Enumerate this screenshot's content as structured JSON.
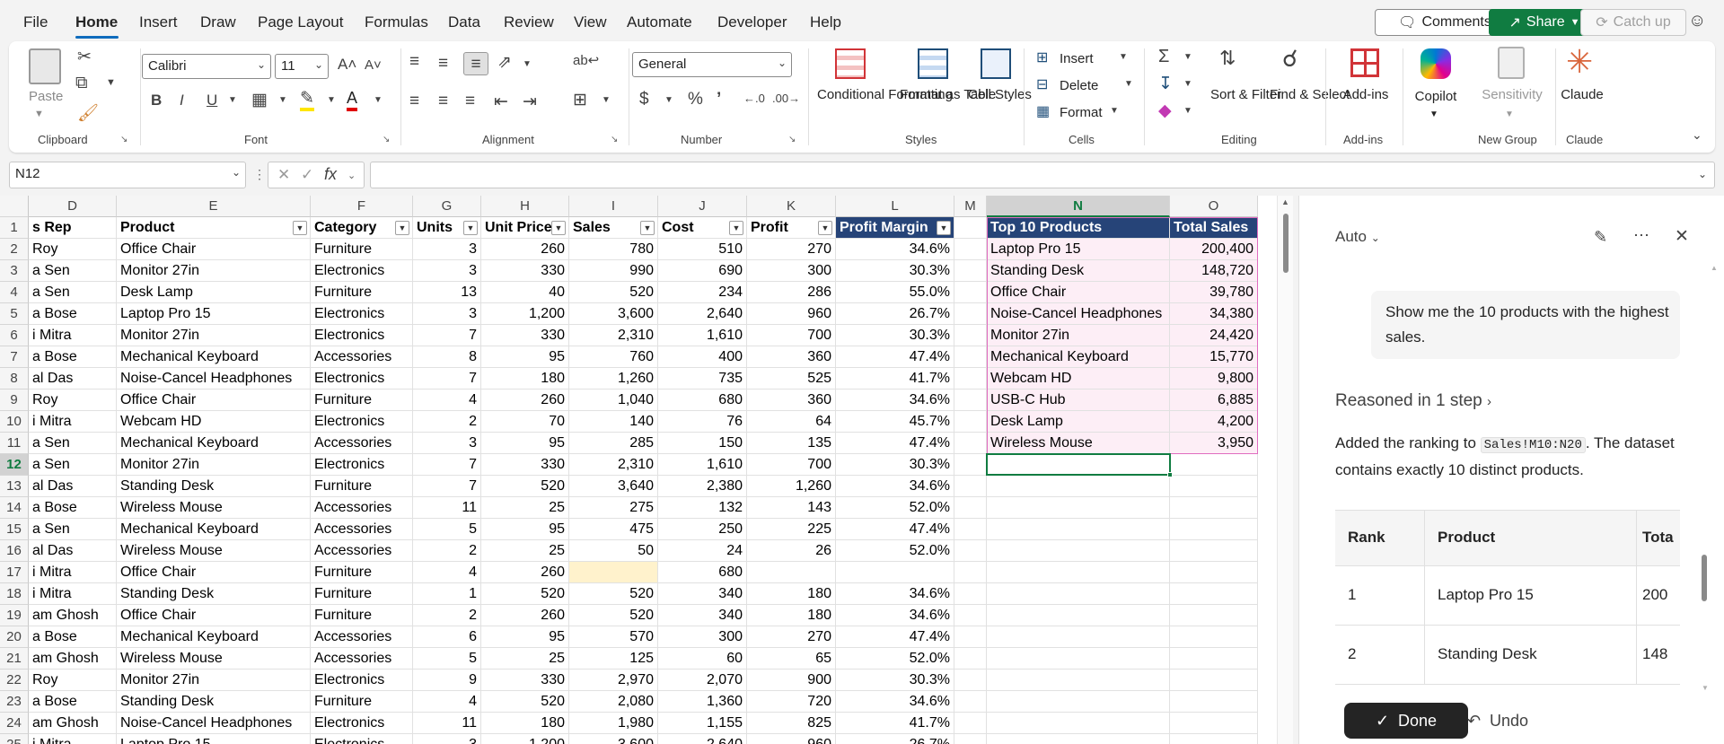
{
  "menu": {
    "tabs": [
      "File",
      "Home",
      "Insert",
      "Draw",
      "Page Layout",
      "Formulas",
      "Data",
      "Review",
      "View",
      "Automate",
      "Developer",
      "Help"
    ],
    "active": "Home",
    "comments_label": "Comments",
    "share_label": "Share",
    "catchup_label": "Catch up"
  },
  "ribbon": {
    "paste_label": "Paste",
    "font_name": "Calibri",
    "font_size": "11",
    "number_format": "General",
    "conditional_formatting": "Conditional Formatting",
    "format_as_table": "Format as Table",
    "cell_styles": "Cell Styles",
    "insert_label": "Insert",
    "delete_label": "Delete",
    "format_label": "Format",
    "sort_filter": "Sort & Filter",
    "find_select": "Find & Select",
    "addins_label": "Add-ins",
    "copilot_label": "Copilot",
    "sensitivity_label": "Sensitivity",
    "claude_label": "Claude",
    "groups": {
      "clipboard": "Clipboard",
      "font": "Font",
      "alignment": "Alignment",
      "number": "Number",
      "styles": "Styles",
      "cells": "Cells",
      "editing": "Editing",
      "addins": "Add-ins",
      "newgroup": "New Group",
      "claude": "Claude"
    }
  },
  "formula_bar": {
    "name_box": "N12",
    "formula": ""
  },
  "sheet": {
    "columns": [
      "D",
      "E",
      "F",
      "G",
      "H",
      "I",
      "J",
      "K",
      "L",
      "M",
      "N",
      "O"
    ],
    "header_row": [
      "s Rep",
      "Product",
      "Category",
      "Units",
      "Unit Price",
      "Sales",
      "Cost",
      "Profit",
      "Profit Margin"
    ],
    "rows": [
      [
        "Roy",
        "Office Chair",
        "Furniture",
        "3",
        "260",
        "780",
        "510",
        "270",
        "34.6%"
      ],
      [
        "a Sen",
        "Monitor 27in",
        "Electronics",
        "3",
        "330",
        "990",
        "690",
        "300",
        "30.3%"
      ],
      [
        "a Sen",
        "Desk Lamp",
        "Furniture",
        "13",
        "40",
        "520",
        "234",
        "286",
        "55.0%"
      ],
      [
        "a Bose",
        "Laptop Pro 15",
        "Electronics",
        "3",
        "1,200",
        "3,600",
        "2,640",
        "960",
        "26.7%"
      ],
      [
        "i Mitra",
        "Monitor 27in",
        "Electronics",
        "7",
        "330",
        "2,310",
        "1,610",
        "700",
        "30.3%"
      ],
      [
        "a Bose",
        "Mechanical Keyboard",
        "Accessories",
        "8",
        "95",
        "760",
        "400",
        "360",
        "47.4%"
      ],
      [
        "al Das",
        "Noise-Cancel Headphones",
        "Electronics",
        "7",
        "180",
        "1,260",
        "735",
        "525",
        "41.7%"
      ],
      [
        "Roy",
        "Office Chair",
        "Furniture",
        "4",
        "260",
        "1,040",
        "680",
        "360",
        "34.6%"
      ],
      [
        "i Mitra",
        "Webcam HD",
        "Electronics",
        "2",
        "70",
        "140",
        "76",
        "64",
        "45.7%"
      ],
      [
        "a Sen",
        "Mechanical Keyboard",
        "Accessories",
        "3",
        "95",
        "285",
        "150",
        "135",
        "47.4%"
      ],
      [
        "a Sen",
        "Monitor 27in",
        "Electronics",
        "7",
        "330",
        "2,310",
        "1,610",
        "700",
        "30.3%"
      ],
      [
        "al Das",
        "Standing Desk",
        "Furniture",
        "7",
        "520",
        "3,640",
        "2,380",
        "1,260",
        "34.6%"
      ],
      [
        "a Bose",
        "Wireless Mouse",
        "Accessories",
        "11",
        "25",
        "275",
        "132",
        "143",
        "52.0%"
      ],
      [
        "a Sen",
        "Mechanical Keyboard",
        "Accessories",
        "5",
        "95",
        "475",
        "250",
        "225",
        "47.4%"
      ],
      [
        "al Das",
        "Wireless Mouse",
        "Accessories",
        "2",
        "25",
        "50",
        "24",
        "26",
        "52.0%"
      ],
      [
        "i Mitra",
        "Office Chair",
        "Furniture",
        "4",
        "260",
        "",
        "680",
        "",
        ""
      ],
      [
        "i Mitra",
        "Standing Desk",
        "Furniture",
        "1",
        "520",
        "520",
        "340",
        "180",
        "34.6%"
      ],
      [
        "am Ghosh",
        "Office Chair",
        "Furniture",
        "2",
        "260",
        "520",
        "340",
        "180",
        "34.6%"
      ],
      [
        "a Bose",
        "Mechanical Keyboard",
        "Accessories",
        "6",
        "95",
        "570",
        "300",
        "270",
        "47.4%"
      ],
      [
        "am Ghosh",
        "Wireless Mouse",
        "Accessories",
        "5",
        "25",
        "125",
        "60",
        "65",
        "52.0%"
      ],
      [
        "Roy",
        "Monitor 27in",
        "Electronics",
        "9",
        "330",
        "2,970",
        "2,070",
        "900",
        "30.3%"
      ],
      [
        "a Bose",
        "Standing Desk",
        "Furniture",
        "4",
        "520",
        "2,080",
        "1,360",
        "720",
        "34.6%"
      ],
      [
        "am Ghosh",
        "Noise-Cancel Headphones",
        "Electronics",
        "11",
        "180",
        "1,980",
        "1,155",
        "825",
        "41.7%"
      ],
      [
        "i Mitra",
        "Laptop Pro 15",
        "Electronics",
        "3",
        "1,200",
        "3,600",
        "2,640",
        "960",
        "26.7%"
      ]
    ],
    "top10": {
      "header_product": "Top 10 Products",
      "header_sales": "Total Sales",
      "rows": [
        [
          "Laptop Pro 15",
          "200,400"
        ],
        [
          "Standing Desk",
          "148,720"
        ],
        [
          "Office Chair",
          "39,780"
        ],
        [
          "Noise-Cancel Headphones",
          "34,380"
        ],
        [
          "Monitor 27in",
          "24,420"
        ],
        [
          "Mechanical Keyboard",
          "15,770"
        ],
        [
          "Webcam HD",
          "9,800"
        ],
        [
          "USB-C Hub",
          "6,885"
        ],
        [
          "Desk Lamp",
          "4,200"
        ],
        [
          "Wireless Mouse",
          "3,950"
        ]
      ]
    }
  },
  "copilot_pane": {
    "mode": "Auto",
    "user_message": "Show me the 10 products with the highest sales.",
    "reasoned": "Reasoned in 1 step",
    "response_pre": "Added the ranking to",
    "response_code": "Sales!M10:N20",
    "response_post": ". The dataset contains exactly 10 distinct products.",
    "table_headers": [
      "Rank",
      "Product",
      "Tota"
    ],
    "table_rows": [
      [
        "1",
        "Laptop Pro 15",
        "200"
      ],
      [
        "2",
        "Standing Desk",
        "148"
      ]
    ],
    "done_label": "Done",
    "undo_label": "Undo"
  }
}
